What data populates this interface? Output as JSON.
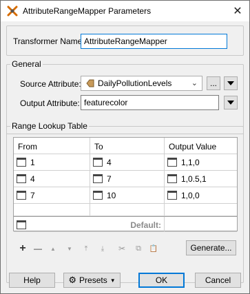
{
  "window": {
    "title": "AttributeRangeMapper Parameters",
    "close": "✕"
  },
  "transformer": {
    "label": "Transformer Name:",
    "value": "AttributeRangeMapper"
  },
  "general": {
    "legend": "General",
    "source_label": "Source Attribute:",
    "source_value": "DailyPollutionLevels",
    "source_more": "...",
    "output_label": "Output Attribute:",
    "output_value": "featurecolor"
  },
  "table": {
    "legend": "Range Lookup Table",
    "headers": {
      "from": "From",
      "to": "To",
      "output": "Output Value"
    },
    "rows": [
      {
        "from": "1",
        "to": "4",
        "output": "1,1,0"
      },
      {
        "from": "4",
        "to": "7",
        "output": "1,0.5,1"
      },
      {
        "from": "7",
        "to": "10",
        "output": "1,0,0"
      }
    ],
    "default_label": "Default:"
  },
  "toolbar": {
    "add": "+",
    "remove": "—",
    "up": "▲",
    "down": "▼",
    "top": "⤒",
    "bottom": "⤓",
    "cut": "✂",
    "copy": "⧉",
    "paste": "📋",
    "generate": "Generate..."
  },
  "footer": {
    "help": "Help",
    "presets": "Presets",
    "ok": "OK",
    "cancel": "Cancel"
  }
}
